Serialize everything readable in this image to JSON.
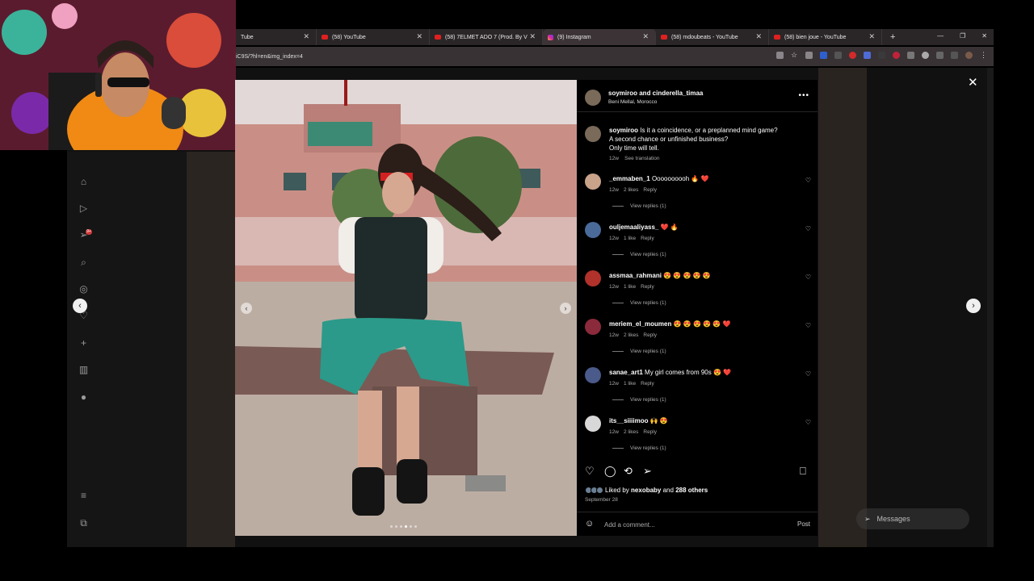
{
  "browser": {
    "tabs": [
      {
        "title": "Tube",
        "favicon": "youtube-icon",
        "active": false
      },
      {
        "title": "(58) YouTube",
        "favicon": "youtube-icon",
        "active": false
      },
      {
        "title": "(58) 7ELMET ADO 7 (Prod. By V",
        "favicon": "youtube-icon",
        "active": false
      },
      {
        "title": "(9) Instagram",
        "favicon": "instagram-icon",
        "active": true
      },
      {
        "title": "(58) mdoubeats - YouTube",
        "favicon": "youtube-icon",
        "active": false
      },
      {
        "title": "(58) bien joue - YouTube",
        "favicon": "youtube-icon",
        "active": false
      }
    ],
    "new_tab": "+",
    "url": "iC9S/?hl=en&img_index=4"
  },
  "post": {
    "header": {
      "users": "soymiroo and cinderella_timaa",
      "location": "Beni Mellal, Morocco",
      "more": "•••"
    },
    "caption": {
      "user": "soymiroo",
      "line1": "Is it a coincidence, or a preplanned mind game?",
      "line2": "A second chance or unfinished business?",
      "line3": "Only time will tell.",
      "age": "12w",
      "translate": "See translation"
    },
    "comments": [
      {
        "user": "_emmaben_1",
        "text": "Oooooooooh 🔥 ❤️",
        "age": "12w",
        "likes": "2 likes",
        "reply": "Reply",
        "replies": "View replies (1)"
      },
      {
        "user": "ouljemaaliyass_",
        "text": "❤️ 🔥",
        "age": "12w",
        "likes": "1 like",
        "reply": "Reply",
        "replies": "View replies (1)"
      },
      {
        "user": "assmaa_rahmani",
        "text": "😍 😍 😍 😍 😍",
        "age": "12w",
        "likes": "1 like",
        "reply": "Reply",
        "replies": "View replies (1)"
      },
      {
        "user": "meriem_el_moumen",
        "text": "😍 😍 😍 😍 😍 ❤️",
        "age": "12w",
        "likes": "2 likes",
        "reply": "Reply",
        "replies": "View replies (1)"
      },
      {
        "user": "sanae_art1",
        "text": "My girl comes from 90s 😍 ❤️",
        "age": "12w",
        "likes": "1 like",
        "reply": "Reply",
        "replies": "View replies (1)"
      },
      {
        "user": "its__siiiimoo",
        "text": "🙌 😍",
        "age": "12w",
        "likes": "2 likes",
        "reply": "Reply",
        "replies": "View replies (1)"
      }
    ],
    "liked_by_prefix": "Liked by",
    "liked_by_user": "nexobaby",
    "liked_by_suffix": "and",
    "liked_by_others": "288 others",
    "date": "September 28",
    "comment_placeholder": "Add a comment...",
    "post_button": "Post",
    "carousel_index": 4,
    "carousel_count": 6
  },
  "messages_pill": "Messages",
  "notif_badge": "9+",
  "colors": {
    "panel_bg": "#000000",
    "accent_red": "#e0201f",
    "text_muted": "#aaaaaa"
  }
}
